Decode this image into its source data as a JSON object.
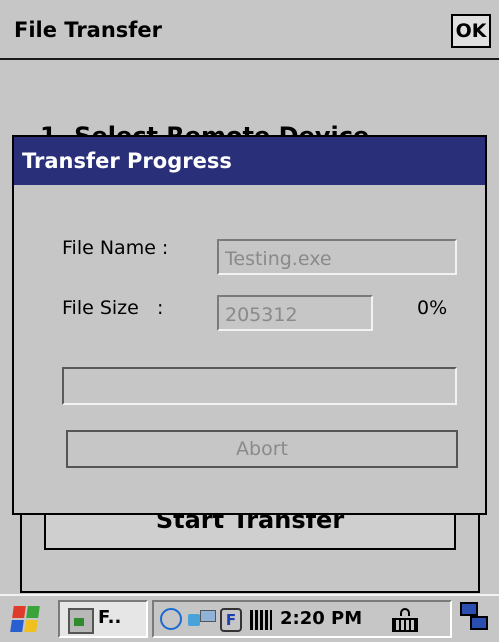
{
  "app": {
    "title": "File Transfer",
    "ok_label": "OK"
  },
  "background": {
    "step_text": "1. Select Remote Device",
    "start_transfer_label": "Start Transfer"
  },
  "dialog": {
    "title": "Transfer Progress",
    "file_name_label": "File Name :",
    "file_name_value": "Testing.exe",
    "file_size_label": "File Size   :",
    "file_size_value": "205312",
    "percent": "0%",
    "progress": 0,
    "abort_label": "Abort"
  },
  "taskbar": {
    "task_label": "F..",
    "clock": "2:20 PM",
    "icons": [
      "start-flag-icon",
      "file-transfer-app-icon",
      "sync-icon",
      "network-icon",
      "f-icon",
      "barcode-icon",
      "keyboard-icon",
      "windows-switch-icon"
    ]
  },
  "colors": {
    "dialog_title_bg": "#2a2f7a",
    "window_bg": "#c6c6c6"
  }
}
